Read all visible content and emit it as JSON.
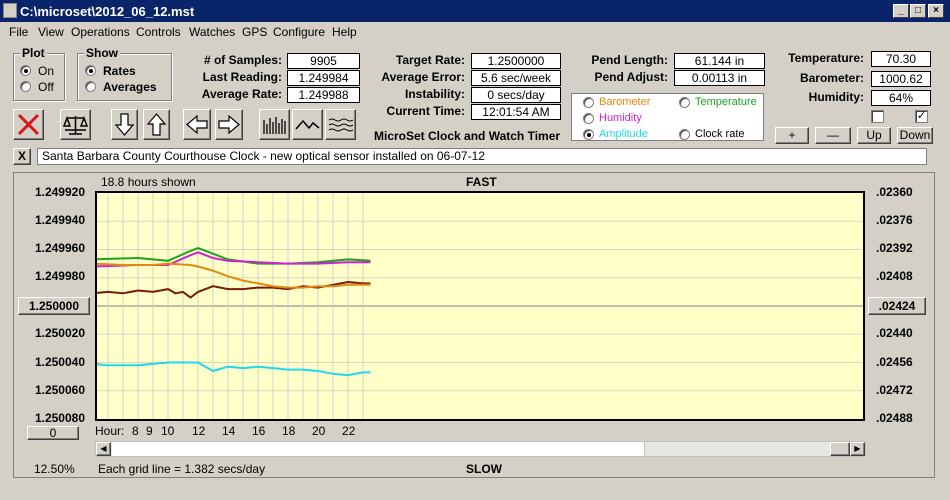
{
  "window": {
    "title": "C:\\microset\\2012_06_12.mst"
  },
  "menu": [
    "File",
    "View",
    "Operations",
    "Controls",
    "Watches",
    "GPS",
    "Configure",
    "Help"
  ],
  "plot_group": {
    "title": "Plot",
    "on": "On",
    "off": "Off",
    "selected": "On"
  },
  "show_group": {
    "title": "Show",
    "rates": "Rates",
    "averages": "Averages",
    "selected": "Rates"
  },
  "stats": {
    "samples_label": "# of Samples:",
    "samples": "9905",
    "last_label": "Last Reading:",
    "last": "1.249984",
    "avg_label": "Average Rate:",
    "avg": "1.249988",
    "target_label": "Target Rate:",
    "target": "1.2500000",
    "avgerr_label": "Average Error:",
    "avgerr": "5.6 sec/week",
    "instab_label": "Instability:",
    "instab": "0 secs/day",
    "time_label": "Current Time:",
    "time": "12:01:54 AM",
    "pendlen_label": "Pend Length:",
    "pendlen": "61.144 in",
    "pendadj_label": "Pend Adjust:",
    "pendadj": "0.00113 in",
    "temp_label": "Temperature:",
    "temp": "70.30",
    "baro_label": "Barometer:",
    "baro": "1000.62",
    "hum_label": "Humidity:",
    "hum": "64%"
  },
  "app_title": "MicroSet Clock and Watch Timer",
  "sensors": {
    "barometer": "Barometer",
    "temperature": "Temperature",
    "humidity": "Humidity",
    "amplitude": "Amplitude",
    "clockrate": "Clock rate",
    "selected": "Amplitude",
    "colors": {
      "barometer": "#e08a10",
      "temperature": "#20a020",
      "humidity": "#d020d0",
      "amplitude": "#20d8f0",
      "clockrate": "#000000"
    }
  },
  "adjust_buttons": {
    "plus": "+",
    "minus": "—",
    "up": "Up",
    "down": "Down"
  },
  "note": "Santa Barbara County Courthouse Clock - new optical sensor installed on 06-07-12",
  "note_close": "X",
  "chart": {
    "hours_shown": "18.8 hours shown",
    "top_label": "FAST",
    "bottom_label": "SLOW",
    "left_ticks": [
      "1.249920",
      "1.249940",
      "1.249960",
      "1.249980",
      "1.250000",
      "1.250020",
      "1.250040",
      "1.250060",
      "1.250080"
    ],
    "right_ticks": [
      ".02360",
      ".02376",
      ".02392",
      ".02408",
      ".02424",
      ".02440",
      ".02456",
      ".02472",
      ".02488"
    ],
    "center_button": "1.250000",
    "right_center_button": ".02424",
    "zero_button": "0",
    "hour_label": "Hour:",
    "hour_ticks": [
      "8",
      "9",
      "10",
      "12",
      "14",
      "16",
      "18",
      "20",
      "22"
    ],
    "zoom": "12.50%",
    "grid_note": "Each grid line = 1.382 secs/day"
  },
  "chart_data": {
    "type": "line",
    "ylim": [
      1.24992,
      1.25008
    ],
    "ylim_right": [
      0.0236,
      0.02488
    ],
    "series": [
      {
        "name": "Clock rate",
        "color": "#7a1a10",
        "x": [
          5.0,
          6.0,
          7.0,
          8.0,
          9.0,
          10.0,
          10.5,
          11.0,
          11.5,
          12.0,
          13.0,
          14.0,
          15.0,
          16.0,
          17.0,
          18.0,
          19.0,
          20.0,
          21.0,
          22.0,
          23.0,
          23.5
        ],
        "y": [
          1.249991,
          1.24999,
          1.249991,
          1.249989,
          1.24999,
          1.249988,
          1.249991,
          1.24999,
          1.249994,
          1.24999,
          1.249986,
          1.249988,
          1.249988,
          1.249987,
          1.249987,
          1.249988,
          1.249986,
          1.249987,
          1.249985,
          1.249983,
          1.249984,
          1.249984
        ]
      },
      {
        "name": "Temperature",
        "color": "#20a020",
        "x": [
          5.0,
          8.0,
          10.0,
          11.5,
          12.0,
          13.0,
          14.0,
          16.0,
          18.0,
          20.0,
          22.0,
          23.5
        ],
        "y": [
          1.249967,
          1.249966,
          1.249968,
          1.249961,
          1.249959,
          1.249963,
          1.249967,
          1.24997,
          1.24997,
          1.249969,
          1.249967,
          1.249968
        ]
      },
      {
        "name": "Humidity",
        "color": "#d020d0",
        "x": [
          5.0,
          8.0,
          10.0,
          11.5,
          12.0,
          13.0,
          14.0,
          16.0,
          18.0,
          20.0,
          22.0,
          23.5
        ],
        "y": [
          1.249972,
          1.249971,
          1.249971,
          1.249964,
          1.249962,
          1.249966,
          1.249968,
          1.249969,
          1.24997,
          1.24997,
          1.249969,
          1.249969
        ]
      },
      {
        "name": "Barometer",
        "color": "#e08a10",
        "x": [
          5.0,
          7.0,
          9.0,
          10.0,
          11.5,
          12.0,
          13.0,
          14.0,
          15.0,
          16.0,
          17.0,
          18.0,
          19.0,
          20.0,
          21.0,
          22.0,
          23.5
        ],
        "y": [
          1.24997,
          1.249971,
          1.249971,
          1.24997,
          1.249971,
          1.249972,
          1.249975,
          1.249979,
          1.249982,
          1.249984,
          1.249986,
          1.249987,
          1.249987,
          1.249986,
          1.249986,
          1.249985,
          1.249985
        ]
      },
      {
        "name": "Amplitude",
        "color": "#20d8f0",
        "x": [
          5.0,
          6.0,
          7.0,
          8.0,
          9.0,
          10.0,
          11.0,
          12.0,
          13.0,
          14.0,
          15.0,
          16.0,
          17.0,
          18.0,
          19.0,
          20.0,
          21.0,
          22.0,
          23.0,
          23.5
        ],
        "y": [
          1.250041,
          1.250042,
          1.250042,
          1.250042,
          1.250041,
          1.25004,
          1.25004,
          1.25004,
          1.250046,
          1.250043,
          1.250044,
          1.250043,
          1.250044,
          1.250045,
          1.250045,
          1.250046,
          1.250048,
          1.250049,
          1.250047,
          1.250047
        ]
      }
    ]
  }
}
